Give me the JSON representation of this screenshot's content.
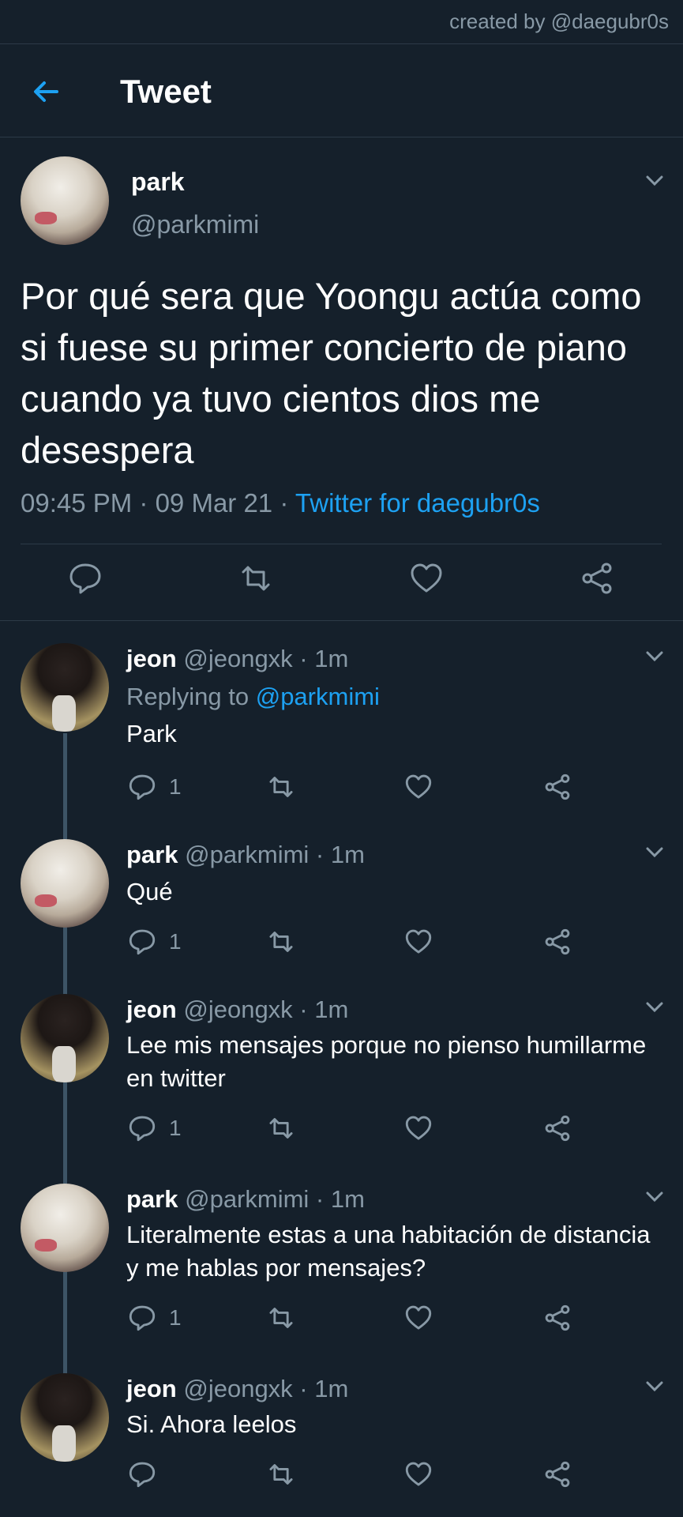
{
  "watermark": "created by @daegubr0s",
  "header": {
    "title": "Tweet",
    "back_icon": "arrow-left-icon"
  },
  "colors": {
    "background": "#15202b",
    "accent": "#1da1f2",
    "muted": "#8899a6",
    "divider": "#2c3a47"
  },
  "main_tweet": {
    "name": "park",
    "handle": "@parkmimi",
    "text": "Por qué sera que Yoongu actúa como si fuese su primer concierto de piano cuando ya tuvo cientos dios me desespera",
    "time": "09:45 PM",
    "date": "09 Mar 21",
    "source": "Twitter for daegubr0s",
    "sep": " · ",
    "actions": [
      "reply-icon",
      "retweet-icon",
      "like-icon",
      "share-icon"
    ]
  },
  "replies": [
    {
      "name": "jeon",
      "handle": "@jeongxk",
      "time": "1m",
      "replying_label": "Replying to ",
      "replying_to": "@parkmimi",
      "text": "Park",
      "reply_count": "1"
    },
    {
      "name": "park",
      "handle": "@parkmimi",
      "time": "1m",
      "text": "Qué",
      "reply_count": "1"
    },
    {
      "name": "jeon",
      "handle": "@jeongxk",
      "time": "1m",
      "text": "Lee mis mensajes porque no pienso humillarme en twitter",
      "reply_count": "1"
    },
    {
      "name": "park",
      "handle": "@parkmimi",
      "time": "1m",
      "text": "Literalmente estas a una habitación de distancia y me hablas por mensajes?",
      "reply_count": "1"
    },
    {
      "name": "jeon",
      "handle": "@jeongxk",
      "time": "1m",
      "text": "Si. Ahora leelos",
      "reply_count": ""
    }
  ]
}
